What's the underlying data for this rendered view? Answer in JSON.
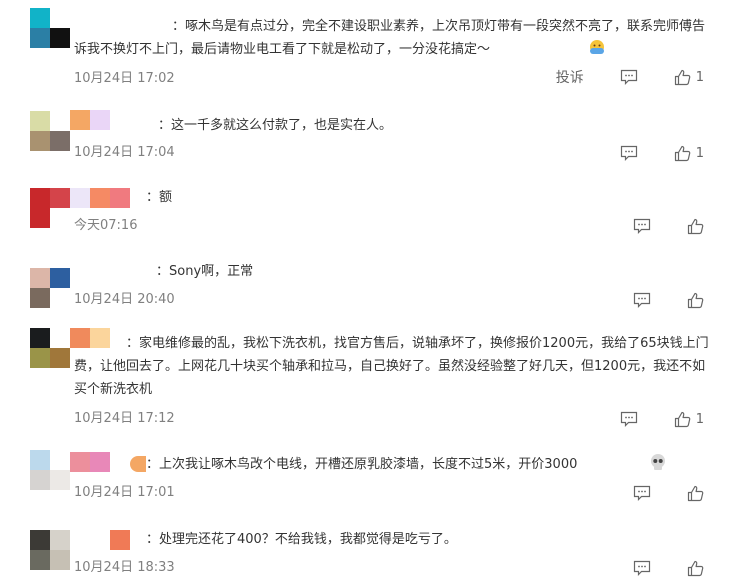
{
  "comments": [
    {
      "text": "：啄木鸟是有点过分，完全不建设职业素养，上次吊顶灯带有一段突然不亮了，联系完师傅告诉我不换灯不上门，最后请物业电工看了下就是松动了，一分没花搞定～",
      "emoji": "hug-emoji",
      "time": "10月24日 17:02",
      "report": "投诉",
      "likes": "1"
    },
    {
      "text": "：这一千多就这么付款了，也是实在人。",
      "time": "10月24日 17:04",
      "likes": "1"
    },
    {
      "text": "：额",
      "time": "今天07:16",
      "likes": ""
    },
    {
      "text": "：Sony啊，正常",
      "time": "10月24日 20:40",
      "likes": ""
    },
    {
      "text": "：家电维修最的乱，我松下洗衣机，找官方售后，说轴承坏了，换修报价1200元，我给了65块钱上门费，让他回去了。上网花几十块买个轴承和拉马，自己换好了。虽然没经验整了好几天，但1200元，我还不如买个新洗衣机",
      "time": "10月24日 17:12",
      "likes": "1"
    },
    {
      "text": "：上次我让啄木鸟改个电线，开槽还原乳胶漆墙，长度不过5米，开价3000",
      "emoji": "skull-emoji",
      "time": "10月24日 17:01",
      "likes": ""
    },
    {
      "text": "：处理完还花了400？不给我钱，我都觉得是吃亏了。",
      "time": "10月24日 18:33",
      "likes": ""
    }
  ],
  "colors": {
    "text": "#333333",
    "time": "#808080",
    "icon": "#666666"
  }
}
